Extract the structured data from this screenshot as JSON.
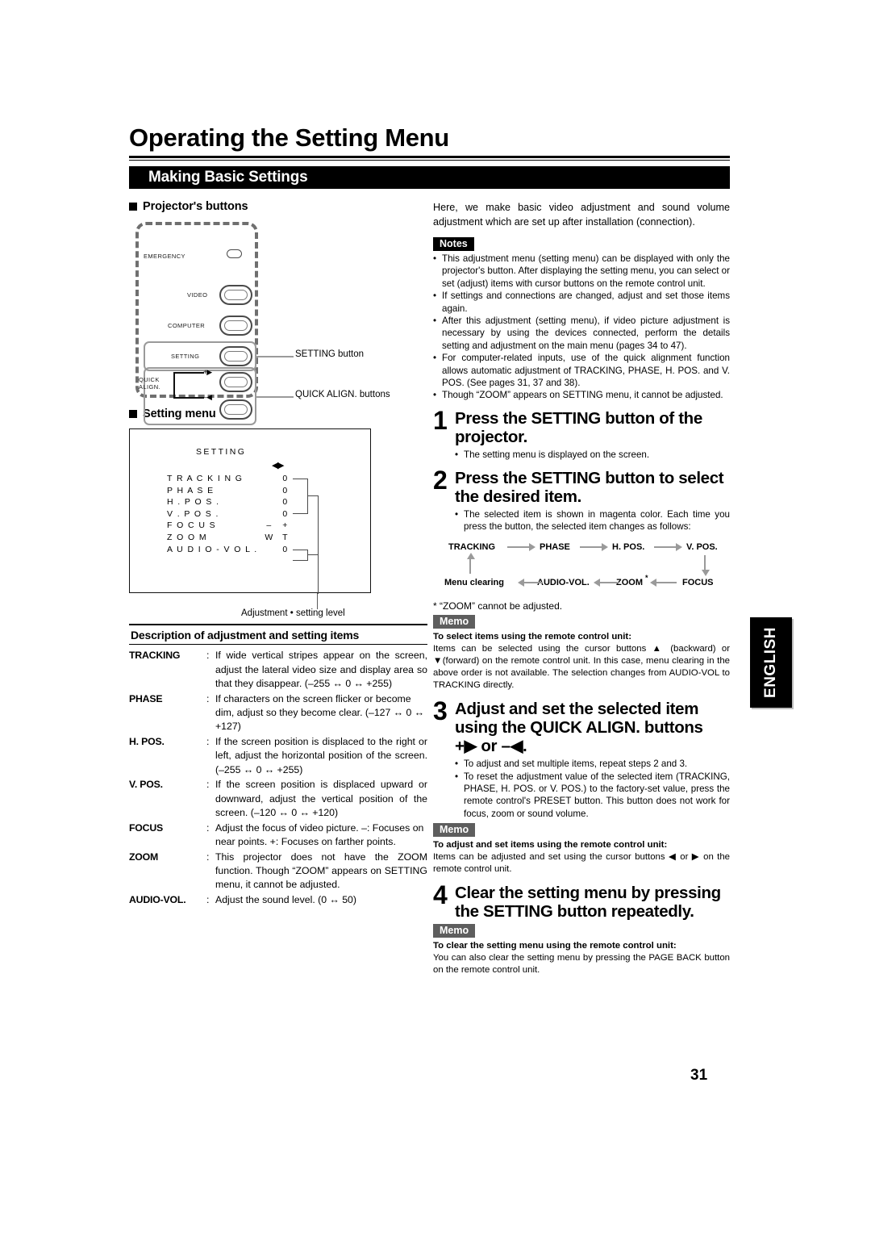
{
  "header": {
    "title": "Operating the Setting Menu",
    "section_bar": "Making Basic Settings"
  },
  "left": {
    "projector_buttons_heading": "Projector's buttons",
    "panel": {
      "emergency": "EMERGENCY",
      "video": "VIDEO",
      "computer": "COMPUTER",
      "setting": "SETTING",
      "quick": "QUICK",
      "align": "ALIGN.",
      "plus_arrow": "+▶",
      "minus_arrow": "–◀",
      "callout_setting": "SETTING button",
      "callout_quick": "QUICK ALIGN. buttons"
    },
    "setting_menu_heading": "Setting menu",
    "screen": {
      "title": "SETTING",
      "cursor_arrows": "◀▶",
      "rows": [
        {
          "name": "T R A C K I N G",
          "v1": "",
          "v2": "0"
        },
        {
          "name": "P H A S E",
          "v1": "",
          "v2": "0"
        },
        {
          "name": "H . P O S .",
          "v1": "",
          "v2": "0"
        },
        {
          "name": "V . P O S .",
          "v1": "",
          "v2": "0"
        },
        {
          "name": "F O C U S",
          "v1": "–",
          "v2": "+"
        },
        {
          "name": "Z O O M",
          "v1": "W",
          "v2": "T"
        },
        {
          "name": "A U D I O  - V O L .",
          "v1": "",
          "v2": "0"
        }
      ],
      "caption": "Adjustment • setting level"
    },
    "desc_title": "Description of adjustment and setting items",
    "desc_rows": [
      {
        "term": "TRACKING",
        "colon": ":",
        "body": "If wide vertical stripes appear on the screen, adjust the lateral video size and display area so that they disappear. (–255 ↔ 0 ↔ +255)"
      },
      {
        "term": "PHASE",
        "colon": ":",
        "body": "If characters on the screen flicker or become dim, adjust so they become clear. (–127 ↔ 0 ↔ +127)"
      },
      {
        "term": "H. POS.",
        "colon": ":",
        "body": "If the screen position is displaced to the right or left, adjust the horizontal position of the screen. (–255 ↔ 0 ↔ +255)"
      },
      {
        "term": "V. POS.",
        "colon": ":",
        "body": "If the screen position is displaced upward or downward, adjust the vertical position of the screen. (–120 ↔ 0 ↔ +120)"
      },
      {
        "term": "FOCUS",
        "colon": ":",
        "body": "Adjust the focus of video picture. –: Focuses on near points. +: Focuses on farther points."
      },
      {
        "term": "ZOOM",
        "colon": ":",
        "body": "This projector does not have the ZOOM function. Though “ZOOM” appears on SETTING menu, it cannot be adjusted."
      },
      {
        "term": "AUDIO-VOL.",
        "colon": ":",
        "body": "Adjust the sound level. (0 ↔ 50)"
      }
    ]
  },
  "right": {
    "intro": "Here, we make basic video adjustment and sound volume adjustment which are set up after installation (connection).",
    "notes_label": "Notes",
    "notes": [
      "This adjustment menu (setting menu) can be displayed with only the projector's button. After displaying the setting menu, you can select or set (adjust) items with cursor buttons on the remote control unit.",
      "If settings and connections are changed, adjust and set those items again.",
      "After this adjustment (setting menu), if video picture adjustment is necessary by using the devices connected, perform the details setting and adjustment on the main menu (pages 34 to 47).",
      "For computer-related inputs, use of the quick alignment function allows automatic adjustment of TRACKING, PHASE, H. POS. and V. POS. (See pages 31, 37 and 38).",
      "Though “ZOOM” appears on SETTING menu, it cannot be adjusted."
    ],
    "steps": [
      {
        "num": "1",
        "title": "Press the SETTING button of the projector.",
        "bullets": [
          "The setting menu is displayed on the screen."
        ]
      },
      {
        "num": "2",
        "title": "Press the SETTING button to select the desired item.",
        "bullets": [
          "The selected item is shown in magenta color. Each time you press the button, the selected item changes as follows:"
        ]
      },
      {
        "num": "3",
        "title": "Adjust and set the selected item using the QUICK ALIGN. buttons +▶ or –◀.",
        "bullets": [
          "To adjust and set multiple items, repeat steps 2 and 3.",
          "To reset the adjustment value of the selected item (TRACKING, PHASE, H. POS. or V. POS.) to the factory-set value, press the remote control's PRESET button. This button does not work for focus, zoom or sound volume."
        ]
      },
      {
        "num": "4",
        "title": "Clear the setting menu by pressing the SETTING button repeatedly.",
        "bullets": []
      }
    ],
    "step3_title_line1": "Adjust and set the selected item",
    "step3_title_line2": "using the QUICK ALIGN. buttons",
    "step3_title_line3": "+▶ or –◀.",
    "flow": {
      "tracking": "TRACKING",
      "phase": "PHASE",
      "hpos": "H. POS.",
      "vpos": "V. POS.",
      "menu_clearing": "Menu clearing",
      "audio_vol": "AUDIO-VOL.",
      "zoom": "ZOOM",
      "zoom_star": "*",
      "focus": "FOCUS"
    },
    "zoom_footnote": "*  “ZOOM” cannot be adjusted.",
    "memo_label": "Memo",
    "memo1": {
      "strong": "To select items using the remote control unit:",
      "body": "Items can be selected using the cursor buttons ▲ (backward) or ▼(forward) on the remote control unit. In this case, menu clearing in the above order is not available. The selection changes from AUDIO-VOL to TRACKING directly."
    },
    "memo2": {
      "strong": "To adjust and set items using the remote control unit:",
      "body": "Items can be adjusted and set using the cursor buttons ◀ or ▶ on the remote control unit."
    },
    "memo3": {
      "strong": "To clear the setting menu using the remote control unit:",
      "body": "You can also clear the setting menu by pressing the PAGE BACK button on the remote control unit."
    }
  },
  "side_tab": "ENGLISH",
  "page_number": "31"
}
